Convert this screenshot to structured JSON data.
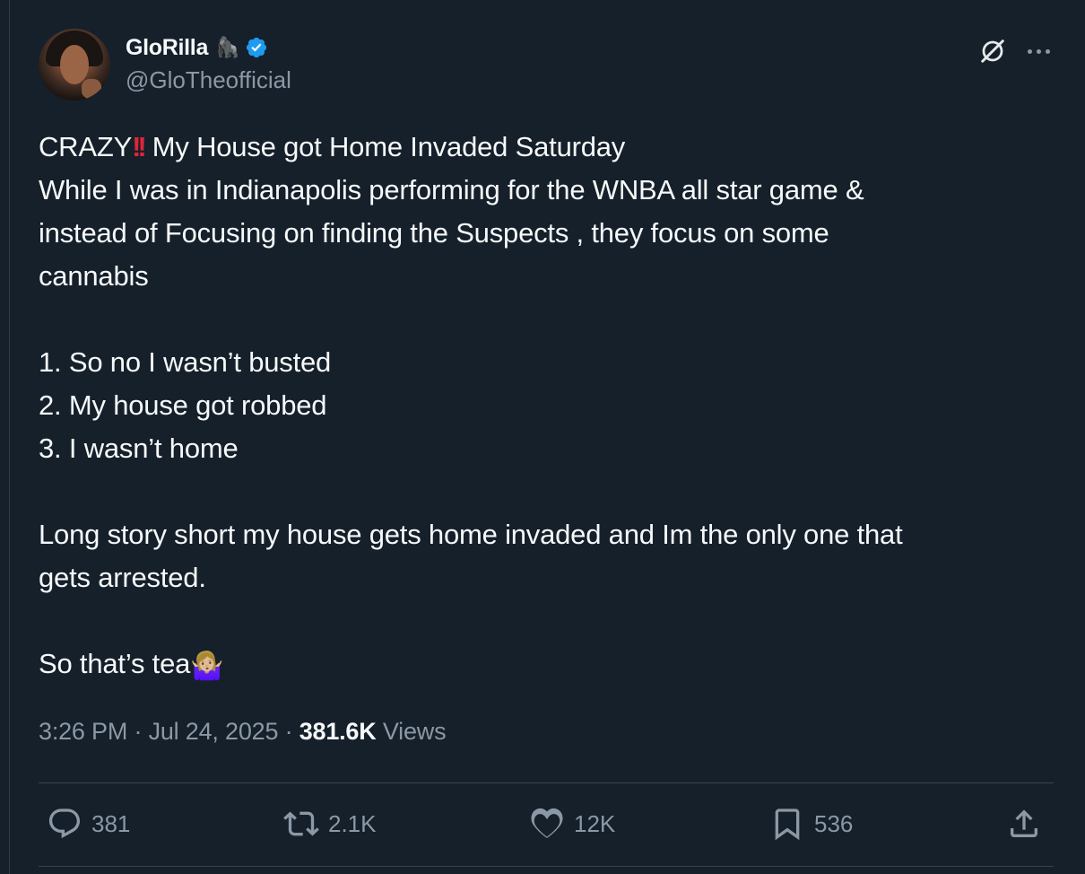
{
  "author": {
    "display_name": "GloRilla",
    "name_emoji": "🦍",
    "handle": "@GloTheofficial",
    "verified": true
  },
  "tweet": {
    "line1_before": "CRAZY",
    "line1_emoji": "‼️",
    "line1_after": "My House got Home Invaded Saturday",
    "line2": "While I was in Indianapolis performing for the WNBA all star game &",
    "line3": "instead of Focusing on finding the Suspects , they focus on some",
    "line4": "cannabis",
    "list": [
      "1. So no I wasn’t  busted",
      "2. My house got robbed",
      "3. I wasn’t home"
    ],
    "paragraph2_line1": "Long story short my house gets home invaded and Im the only one that",
    "paragraph2_line2": "gets arrested.",
    "closing": "So that’s tea",
    "closing_emoji": "🤷🏼‍♀️"
  },
  "meta": {
    "time": "3:26 PM",
    "separator": " · ",
    "date": "Jul 24, 2025",
    "views_count": "381.6K",
    "views_label": " Views"
  },
  "stats": {
    "replies": "381",
    "reposts": "2.1K",
    "likes": "12K",
    "bookmarks": "536"
  },
  "colors": {
    "background": "#15202b",
    "text": "#f7f9f9",
    "secondary": "#8b98a5",
    "divider": "#38444d",
    "verified": "#1d9bf0",
    "alert": "#e0243a"
  },
  "icons": [
    "grok-icon",
    "more-icon",
    "verified-icon",
    "reply-icon",
    "retweet-icon",
    "like-icon",
    "bookmark-icon",
    "share-icon"
  ]
}
